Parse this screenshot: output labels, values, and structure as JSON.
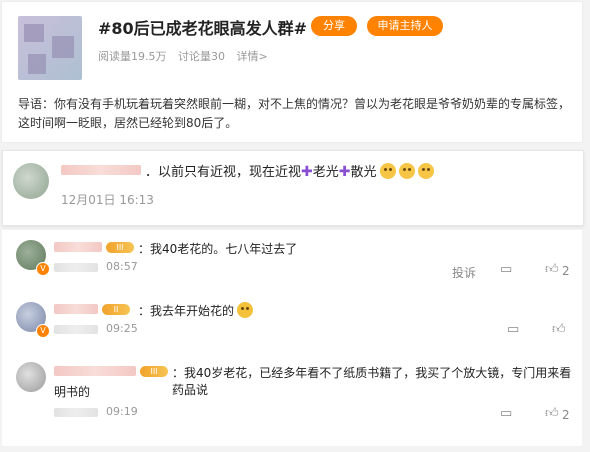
{
  "topic": {
    "title": "#80后已成老花眼高发人群#",
    "share_label": "分享",
    "host_label": "申请主持人",
    "stats": {
      "reads": "阅读量19.5万",
      "discussions": "讨论量30",
      "details": "详情>"
    },
    "intro": "导语：你有没有手机玩着玩着突然眼前一糊，对不上焦的情况？曾以为老花眼是爷爷奶奶辈的专属标签，这时间啊一眨眼，居然已经轮到80后了。"
  },
  "main_comment": {
    "text_part1": "．以前只有近视，现在近视",
    "plus": "✚",
    "word2": "老光",
    "word3": "散光",
    "emoji_icon": "doge-icon",
    "time": "12月01日 16:13"
  },
  "replies": [
    {
      "text": "：我40老花的。七八年过去了",
      "time": "08:57",
      "report_label": "投诉",
      "like_count": "2"
    },
    {
      "text": "：我去年开始花的",
      "time": "09:25",
      "like_count": ""
    },
    {
      "text_line1": "：我40岁老花，已经多年看不了纸质书籍了，我买了个放大镜，专门用来看药品说",
      "text_line2": "明书的",
      "time": "09:19",
      "like_count": "2"
    }
  ],
  "colors": {
    "accent": "#ff8200",
    "plus": "#8a4fd1"
  }
}
